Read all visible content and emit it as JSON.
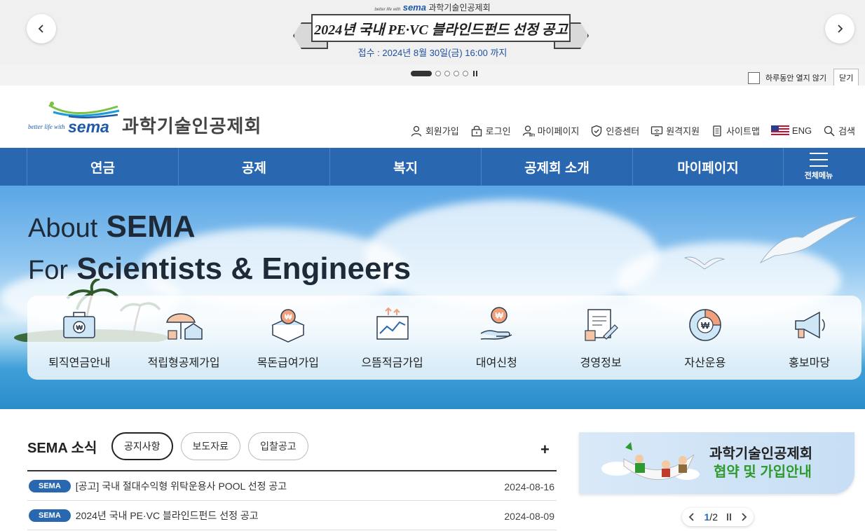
{
  "popup": {
    "logo_tagline": "better life with",
    "logo_brand": "sema",
    "logo_name": "과학기술인공제회",
    "headline": "2024년 국내 PE·VC 블라인드펀드 선정 공고",
    "subtext": "접수 : 2024년 8월 30일(금) 16:00 까지",
    "slide_count": 5,
    "active_slide": 1,
    "today_close_label": "하루동안 열지 않기",
    "close_label": "닫기"
  },
  "header": {
    "logo_tagline": "better life with",
    "logo_brand": "sema",
    "logo_name": "과학기술인공제회",
    "util": [
      {
        "label": "회원가입",
        "icon": "user-icon"
      },
      {
        "label": "로그인",
        "icon": "lock-icon"
      },
      {
        "label": "마이페이지",
        "icon": "my-user-icon"
      },
      {
        "label": "인증센터",
        "icon": "shield-icon"
      },
      {
        "label": "원격지원",
        "icon": "remote-support-icon"
      },
      {
        "label": "사이트맵",
        "icon": "sitemap-icon"
      },
      {
        "label": "ENG",
        "icon": "us-flag-icon"
      },
      {
        "label": "검색",
        "icon": "search-icon"
      }
    ]
  },
  "gnb": {
    "items": [
      "연금",
      "공제",
      "복지",
      "공제회 소개",
      "마이페이지"
    ],
    "all_menu_label": "전체메뉴"
  },
  "hero": {
    "line1_thin": "About",
    "line1_bold": "SEMA",
    "line2_thin": "For",
    "line2_bold": "Scientists & Engineers"
  },
  "quick": [
    {
      "label": "퇴직연금안내",
      "icon": "briefcase-won-icon"
    },
    {
      "label": "적립형공제가입",
      "icon": "umbrella-house-icon"
    },
    {
      "label": "목돈급여가입",
      "icon": "box-won-icon"
    },
    {
      "label": "으뜸적금가입",
      "icon": "chart-growth-icon"
    },
    {
      "label": "대여신청",
      "icon": "hand-coin-icon"
    },
    {
      "label": "경영정보",
      "icon": "document-pen-icon"
    },
    {
      "label": "자산운용",
      "icon": "donut-won-icon"
    },
    {
      "label": "홍보마당",
      "icon": "megaphone-icon"
    }
  ],
  "news": {
    "title": "SEMA 소식",
    "tabs": [
      "공지사항",
      "보도자료",
      "입찰공고"
    ],
    "active_tab": 0,
    "more_label": "+",
    "rows": [
      {
        "badge": "SEMA",
        "title": "[공고] 국내 절대수익형 위탁운용사 POOL 선정 공고",
        "date": "2024-08-16"
      },
      {
        "badge": "SEMA",
        "title": "2024년 국내 PE·VC 블라인드펀드 선정 공고",
        "date": "2024-08-09"
      }
    ]
  },
  "side_banner": {
    "line1": "과학기술인공제회",
    "line2": "협약 및 가입안내",
    "pager_current": "1",
    "pager_sep": "/",
    "pager_total": "2"
  },
  "colors": {
    "primary": "#2a67b1",
    "accent_green": "#2d9a2d"
  }
}
